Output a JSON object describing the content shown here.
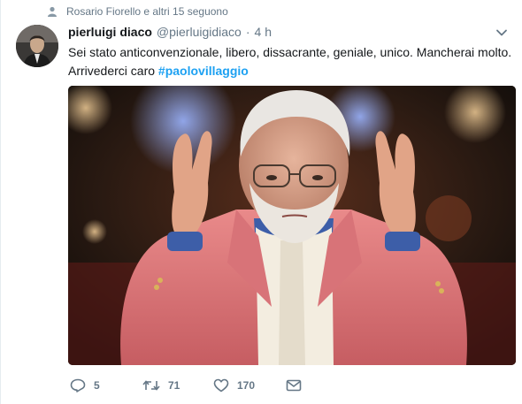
{
  "context": {
    "icon": "person-icon",
    "text": "Rosario Fiorello e altri 15 seguono"
  },
  "author": {
    "fullname": "pierluigi diaco",
    "handle": "@pierluigidiaco",
    "separator": "·",
    "time": "4 h"
  },
  "tweet": {
    "text": "Sei stato anticonvenzionale, libero, dissacrante, geniale, unico. Mancherai molto. Arrivederci caro ",
    "hashtag": "#paolovillaggio"
  },
  "media": {
    "description_icon": "photo"
  },
  "actions": {
    "reply_count": "5",
    "retweet_count": "71",
    "like_count": "170",
    "icons": [
      "reply-icon",
      "retweet-icon",
      "like-icon",
      "direct-message-icon"
    ]
  },
  "colors": {
    "accent": "#1da1f2",
    "secondary_text": "#657786",
    "primary_text": "#14171a"
  }
}
